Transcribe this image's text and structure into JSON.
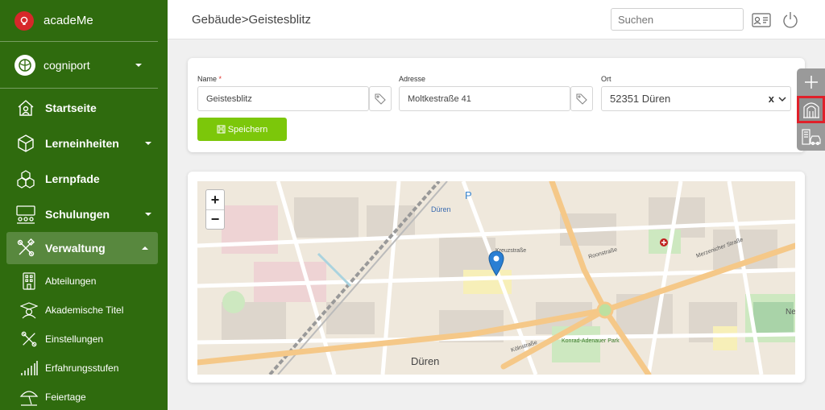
{
  "app": {
    "name": "acadeMe",
    "organization": "cogniport"
  },
  "sidebar": {
    "items": [
      {
        "label": "Startseite",
        "icon": "home-icon"
      },
      {
        "label": "Lerneinheiten",
        "icon": "cube-icon"
      },
      {
        "label": "Lernpfade",
        "icon": "cubes-icon"
      },
      {
        "label": "Schulungen",
        "icon": "classroom-icon"
      },
      {
        "label": "Verwaltung",
        "icon": "tools-icon"
      }
    ],
    "sub_items": [
      {
        "label": "Abteilungen",
        "icon": "building-icon"
      },
      {
        "label": "Akademische Titel",
        "icon": "graduate-icon"
      },
      {
        "label": "Einstellungen",
        "icon": "tools-icon"
      },
      {
        "label": "Erfahrungsstufen",
        "icon": "bars-icon"
      },
      {
        "label": "Feiertage",
        "icon": "beach-umbrella-icon"
      }
    ]
  },
  "header": {
    "breadcrumb_parent": "Gebäude",
    "breadcrumb_sep": ">",
    "breadcrumb_current": "Geistesblitz",
    "search_placeholder": "Suchen"
  },
  "form": {
    "name_label": "Name",
    "name_required_mark": "*",
    "name_value": "Geistesblitz",
    "address_label": "Adresse",
    "address_value": "Moltkestraße 41",
    "city_label": "Ort",
    "city_value": "52351 Düren",
    "clear_label": "x",
    "save_label": "Speichern"
  },
  "map": {
    "zoom_in": "+",
    "zoom_out": "−",
    "labels": {
      "city": "Düren",
      "station": "Düren",
      "park": "Konrad-Adenauer Park",
      "parking": "P",
      "ne": "Ne",
      "roon": "Roonstraße",
      "koln": "Kölnstraße",
      "kreuz": "Kreuzstraße",
      "merzen": "Merzenicher Straße"
    }
  },
  "colors": {
    "sidebar": "#2f6b0e",
    "accent": "#7cc70a",
    "highlight": "#e0202a"
  }
}
